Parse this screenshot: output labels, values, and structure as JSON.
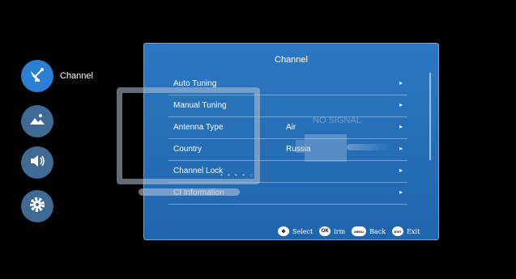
{
  "sidebar": {
    "items": [
      {
        "label": "Channel",
        "icon": "satellite-dish-icon",
        "active": true
      },
      {
        "label": "",
        "icon": "picture-icon",
        "active": false
      },
      {
        "label": "",
        "icon": "sound-icon",
        "active": false
      },
      {
        "label": "",
        "icon": "settings-gear-icon",
        "active": false
      }
    ]
  },
  "panel": {
    "title": "Channel",
    "rows": [
      {
        "label": "Auto Tuning",
        "value": "",
        "arrow": "▸"
      },
      {
        "label": "Manual Tuning",
        "value": "",
        "arrow": "▸"
      },
      {
        "label": "Antenna Type",
        "value": "Air",
        "arrow": "▸"
      },
      {
        "label": "Country",
        "value": "Russia",
        "arrow": "▸"
      },
      {
        "label": "Channel Lock",
        "value": "",
        "arrow": "▸"
      },
      {
        "label": "CI Information",
        "value": "",
        "arrow": "▸"
      }
    ]
  },
  "overlay": {
    "no_signal": "NO SIGNAL"
  },
  "footer": {
    "select_label": "Select",
    "ok_key": "OK",
    "confirm_label": "irm",
    "menu_key": "MENU",
    "back_label": "Back",
    "exit_key": "EXIT",
    "exit_label": "Exit"
  },
  "colors": {
    "panel": "#2572ba",
    "active_icon": "#2a7fd3",
    "inactive_icon": "#3f6a93"
  }
}
